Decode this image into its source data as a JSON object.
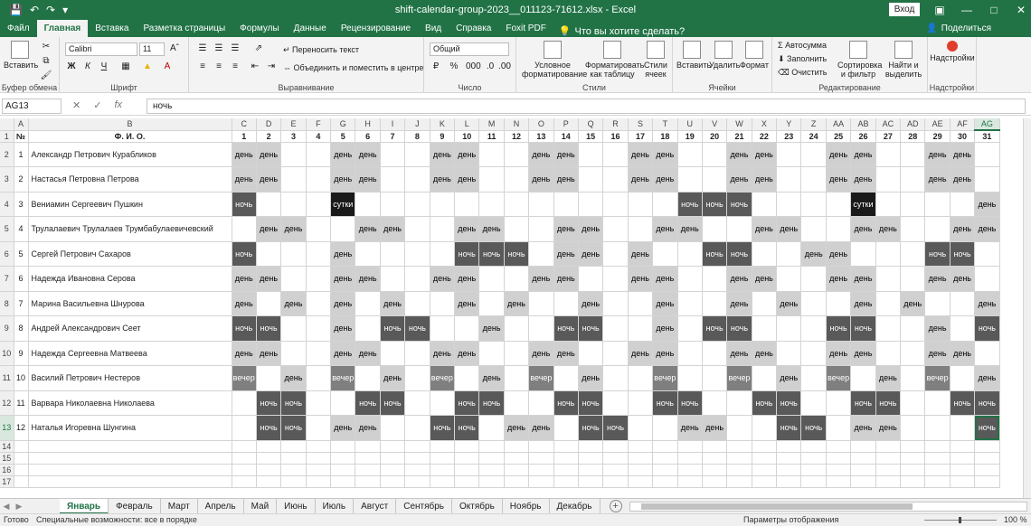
{
  "window": {
    "title": "shift-calendar-group-2023__011123-71612.xlsx - Excel",
    "signin": "Вход",
    "share": "Поделиться"
  },
  "tabs": [
    "Файл",
    "Главная",
    "Вставка",
    "Разметка страницы",
    "Формулы",
    "Данные",
    "Рецензирование",
    "Вид",
    "Справка",
    "Foxit PDF"
  ],
  "tell_me": "Что вы хотите сделать?",
  "ribbon": {
    "paste": "Вставить",
    "clipboard": "Буфер обмена",
    "font_name": "Calibri",
    "font_size": "11",
    "font": "Шрифт",
    "wrap": "Переносить текст",
    "merge": "Объединить и поместить в центре",
    "alignment": "Выравнивание",
    "number_format": "Общий",
    "number": "Число",
    "cond_format": "Условное форматирование",
    "format_table": "Форматировать как таблицу",
    "cell_styles": "Стили ячеек",
    "styles": "Стили",
    "insert": "Вставить",
    "delete": "Удалить",
    "format": "Формат",
    "cells": "Ячейки",
    "autosum": "Автосумма",
    "fill": "Заполнить",
    "clear": "Очистить",
    "sort": "Сортировка и фильтр",
    "find": "Найти и выделить",
    "editing": "Редактирование",
    "addins": "Надстройки",
    "addins_group": "Надстройки"
  },
  "formula": {
    "namebox": "AG13",
    "value": "ночь"
  },
  "grid": {
    "col_letters": [
      "A",
      "B",
      "C",
      "D",
      "E",
      "F",
      "G",
      "H",
      "I",
      "J",
      "K",
      "L",
      "M",
      "N",
      "O",
      "P",
      "Q",
      "R",
      "S",
      "T",
      "U",
      "V",
      "W",
      "X",
      "Y",
      "Z",
      "AA",
      "AB",
      "AC",
      "AD",
      "AE",
      "AF",
      "AG"
    ],
    "header": [
      "№",
      "Ф. И. О.",
      "1",
      "2",
      "3",
      "4",
      "5",
      "6",
      "7",
      "8",
      "9",
      "10",
      "11",
      "12",
      "13",
      "14",
      "15",
      "16",
      "17",
      "18",
      "19",
      "20",
      "21",
      "22",
      "23",
      "24",
      "25",
      "26",
      "27",
      "28",
      "29",
      "30",
      "31"
    ],
    "legend": {
      "day": "день",
      "night": "ночь",
      "evening": "вечер",
      "full": "сутки"
    },
    "rows": [
      {
        "n": "1",
        "name": "Александр Петрович Курабликов",
        "s": "dd..dd..dd..dd..dd..dd..dd..dd.."
      },
      {
        "n": "2",
        "name": "Настасья Петровна Петрова",
        "s": "dd..dd..dd..dd..dd..dd..dd..dd.."
      },
      {
        "n": "3",
        "name": "Вениамин Сергеевич Пушкин",
        "s": "n...f.............nnn....f....d"
      },
      {
        "n": "4",
        "name": "Трулалаевич Трулалаев Трумбабулаевичевский",
        "s": ".dd..dd..dd..dd..dd..dd..dd..dd"
      },
      {
        "n": "5",
        "name": "Сергей Петрович Сахаров",
        "s": "n...d....nnn.dd.d..nn..dd...nn"
      },
      {
        "n": "6",
        "name": "Надежда Ивановна Серова",
        "s": "dd..dd..dd..dd..dd..dd..dd..dd."
      },
      {
        "n": "7",
        "name": "Марина Васильевна Шнурова",
        "s": "d.d.d.d..d.d..d..d..d.d..d.d..d"
      },
      {
        "n": "8",
        "name": "Андрей Александрович Сеет",
        "s": "nn..d.nn..d..nn..d.nn...nn..d.n"
      },
      {
        "n": "9",
        "name": "Надежда Сергеевна Матвеева",
        "s": "dd..dd..dd..dd..dd..dd..dd..dd."
      },
      {
        "n": "10",
        "name": "Василий Петрович Нестеров",
        "s": "e.d.e.d.e.d.e.d..e..e.d.e.d.e.d"
      },
      {
        "n": "11",
        "name": "Варвара Николаевна Николаева",
        "s": ".nn..nn..nn..nn..nn..nn..nn..nn"
      },
      {
        "n": "12",
        "name": "Наталья Игоревна Шунгина",
        "s": ".nn.dd..nn.dd.nn..dd..nn.dd...nn"
      }
    ],
    "row_numbers": [
      "1",
      "2",
      "3",
      "4",
      "5",
      "6",
      "7",
      "8",
      "9",
      "10",
      "11",
      "12",
      "13",
      "14",
      "15",
      "16",
      "17"
    ],
    "selected": {
      "row": 12,
      "col": 32
    }
  },
  "sheets": [
    "Январь",
    "Февраль",
    "Март",
    "Апрель",
    "Май",
    "Июнь",
    "Июль",
    "Август",
    "Сентябрь",
    "Октябрь",
    "Ноябрь",
    "Декабрь"
  ],
  "status": {
    "ready": "Готово",
    "accessibility": "Специальные возможности: все в порядке",
    "view_settings": "Параметры отображения",
    "zoom": "100 %"
  }
}
